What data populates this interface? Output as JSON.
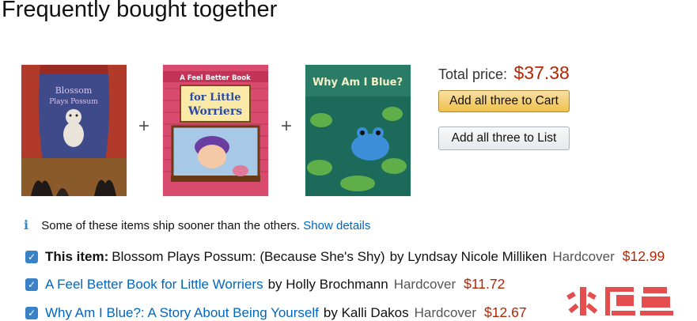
{
  "title": "Frequently bought together",
  "covers": [
    {
      "title_lines": [
        "Blossom",
        "Plays Possum"
      ],
      "alt": "Blossom Plays Possum book cover"
    },
    {
      "series_banner": "A Feel Better Book",
      "title_lines": [
        "for Little",
        "Worriers"
      ],
      "alt": "A Feel Better Book for Little Worriers book cover"
    },
    {
      "title_lines": [
        "Why Am I Blue?"
      ],
      "alt": "Why Am I Blue? book cover"
    }
  ],
  "plus_symbol": "+",
  "total": {
    "label": "Total price:",
    "value": "$37.38"
  },
  "buttons": {
    "cart": "Add all three to Cart",
    "list": "Add all three to List"
  },
  "notice": {
    "text": "Some of these items ship sooner than the others.",
    "link": "Show details"
  },
  "items": [
    {
      "prefix": "This item:",
      "title": "Blossom Plays Possum: (Because She's Shy)",
      "byline": "by Lyndsay Nicole Milliken",
      "format": "Hardcover",
      "price": "$12.99",
      "checked": true
    },
    {
      "prefix": "",
      "title": "A Feel Better Book for Little Worriers",
      "byline": "by Holly Brochmann",
      "format": "Hardcover",
      "price": "$11.72",
      "checked": true
    },
    {
      "prefix": "",
      "title": "Why Am I Blue?: A Story About Being Yourself",
      "byline": "by Kalli Dakos",
      "format": "Hardcover",
      "price": "$12.67",
      "checked": true
    }
  ],
  "watermark": "火鲤鱼",
  "colors": {
    "price": "#B12704",
    "link": "#0066c0",
    "checkbox": "#3a82c8",
    "cart_button": "#f0c14b"
  }
}
